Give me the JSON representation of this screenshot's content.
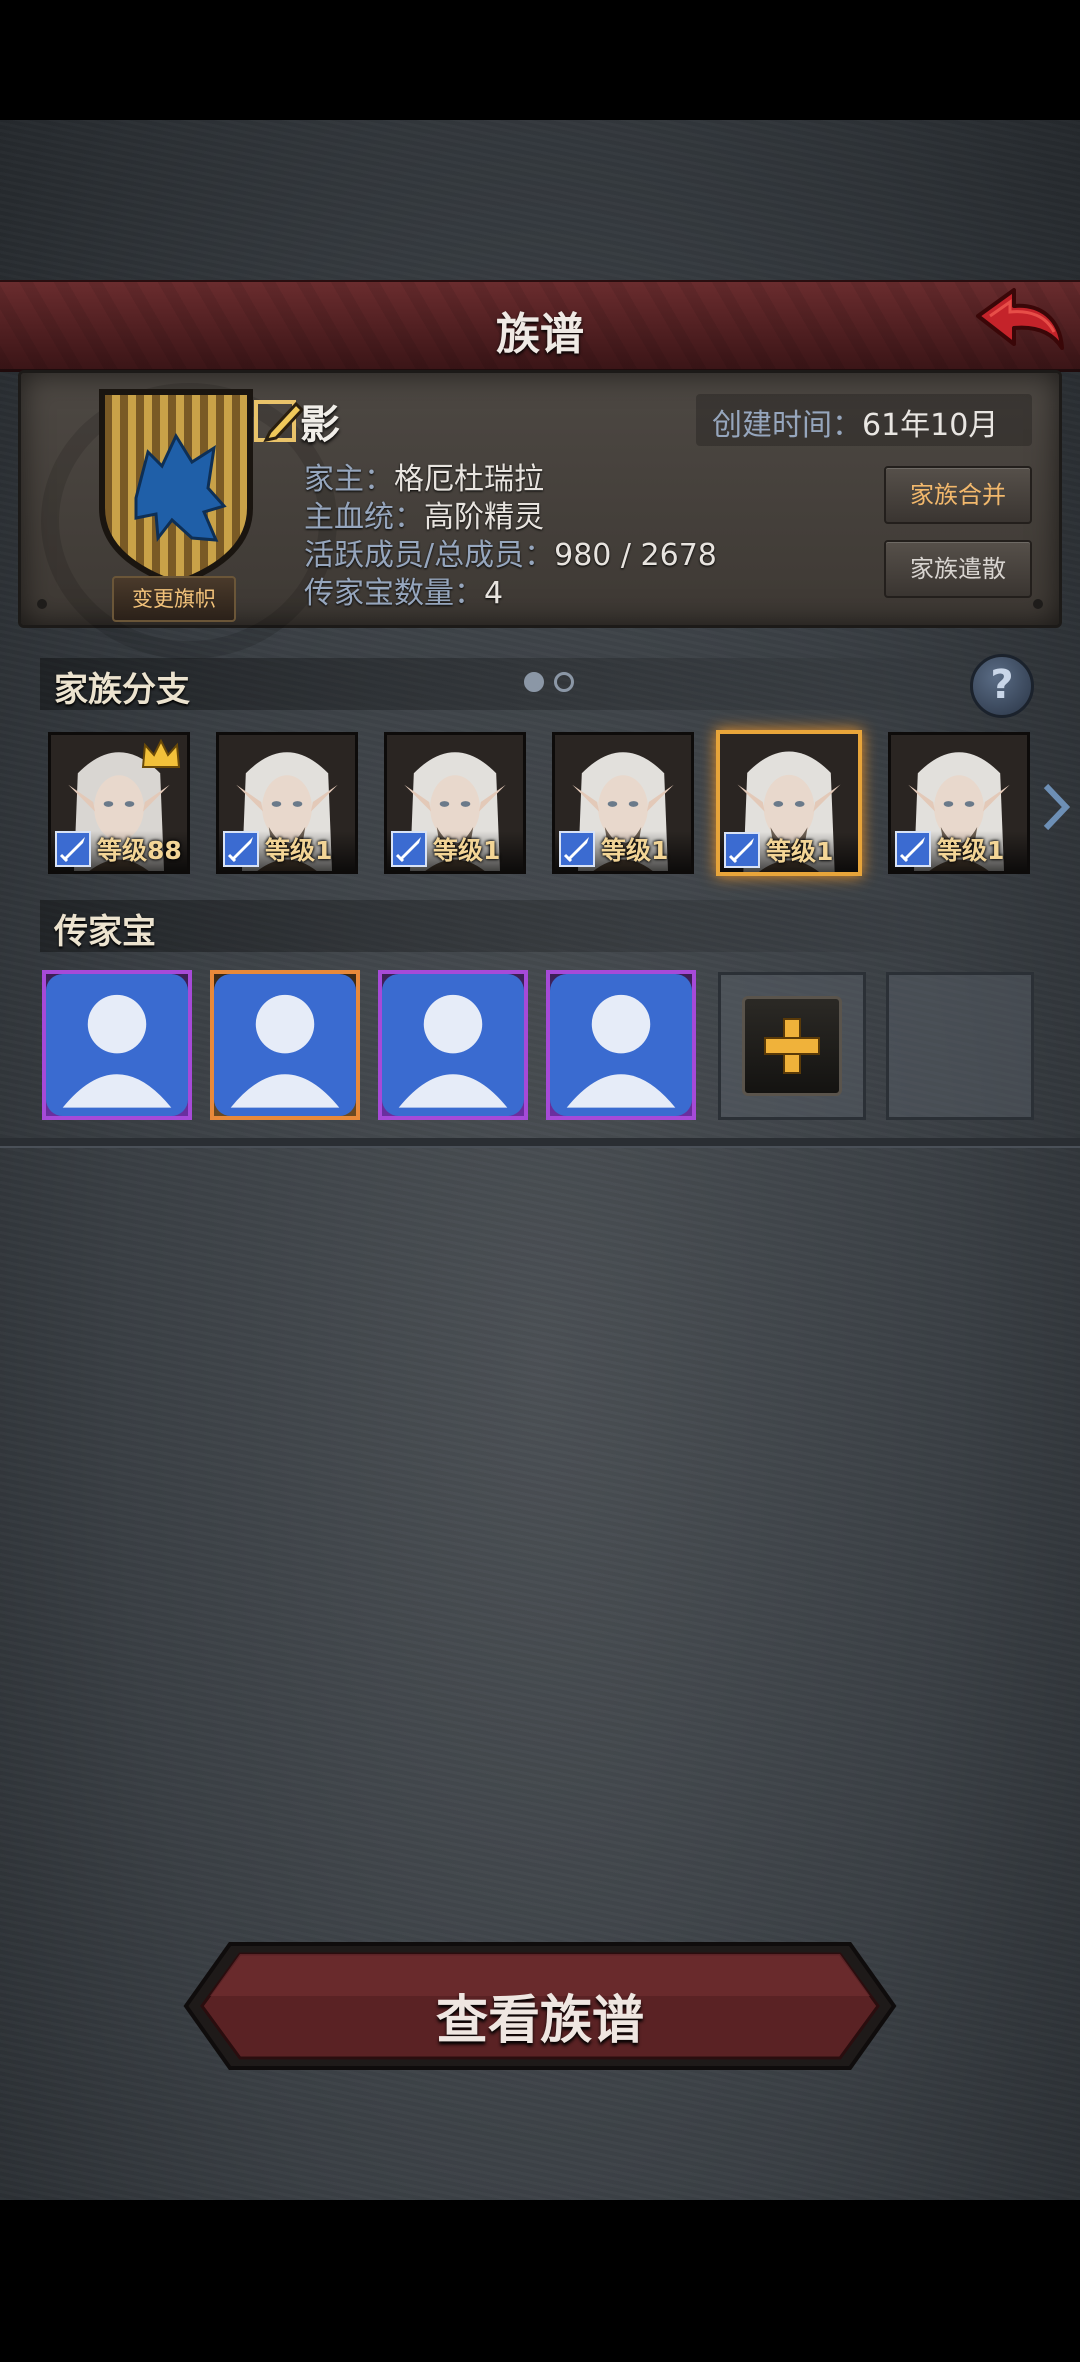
{
  "header": {
    "title": "族谱",
    "back_icon": "back-arrow-icon"
  },
  "family": {
    "name": "影",
    "created_label": "创建时间：",
    "created_value": "61年10月",
    "leader_label": "家主：",
    "leader_value": "格厄杜瑞拉",
    "bloodline_label": "主血统：",
    "bloodline_value": "高阶精灵",
    "members_label": "活跃成员/总成员：",
    "members_value": "980 / 2678",
    "heirloom_count_label": "传家宝数量：",
    "heirloom_count_value": "4",
    "change_flag_label": "变更旗帜",
    "merge_label": "家族合并",
    "disband_label": "家族遣散",
    "banner_icon": "wolf-banner-icon",
    "colors": {
      "banner_stripe_a": "#c9a248",
      "banner_stripe_b": "#7a5a25",
      "wolf": "#1f5fa8"
    }
  },
  "branches": {
    "title": "家族分支",
    "help_label": "?",
    "pages": 2,
    "current_page": 1,
    "items": [
      {
        "level_label": "等级88",
        "leader": true,
        "selected": false
      },
      {
        "level_label": "等级1",
        "leader": false,
        "selected": false
      },
      {
        "level_label": "等级1",
        "leader": false,
        "selected": false
      },
      {
        "level_label": "等级1",
        "leader": false,
        "selected": false
      },
      {
        "level_label": "等级1",
        "leader": false,
        "selected": true
      },
      {
        "level_label": "等级1",
        "leader": false,
        "selected": false
      }
    ]
  },
  "heirlooms": {
    "title": "传家宝",
    "items": [
      {
        "name": "hammer-icon",
        "rarity": "epic"
      },
      {
        "name": "leaf-armor-icon",
        "rarity": "legendary"
      },
      {
        "name": "red-gauntlet-icon",
        "rarity": "epic"
      },
      {
        "name": "fur-armor-icon",
        "rarity": "epic"
      }
    ],
    "add_label": "+"
  },
  "footer": {
    "view_label": "查看族谱"
  },
  "colors": {
    "selected_border": "#e8a53a",
    "epic": "#a64ad8",
    "legendary": "#e8893a",
    "title_bar": "#5a2426"
  }
}
